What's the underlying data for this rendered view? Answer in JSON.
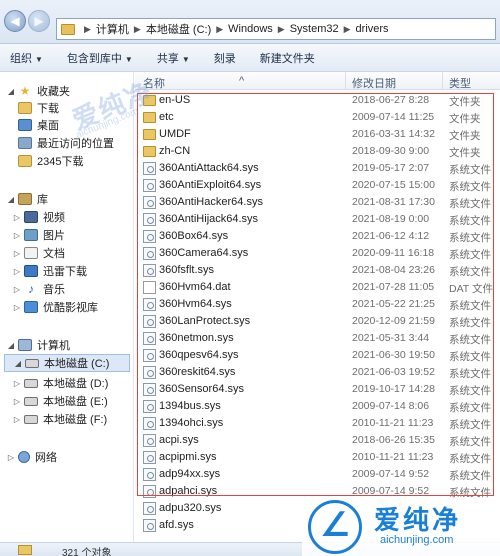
{
  "address": {
    "crumbs": [
      "计算机",
      "本地磁盘 (C:)",
      "Windows",
      "System32",
      "drivers"
    ]
  },
  "toolbar": {
    "organize": "组织",
    "include_library": "包含到库中",
    "share": "共享",
    "burn": "刻录",
    "new_folder": "新建文件夹"
  },
  "nav": {
    "favorites": "收藏夹",
    "downloads": "下载",
    "desktop": "桌面",
    "recent": "最近访问的位置",
    "downloads2345": "2345下载",
    "library": "库",
    "video": "视频",
    "pictures": "图片",
    "documents": "文档",
    "xunlei": "迅雷下载",
    "music": "音乐",
    "youku": "优酷影视库",
    "computer": "计算机",
    "disk_c": "本地磁盘 (C:)",
    "disk_d": "本地磁盘 (D:)",
    "disk_e": "本地磁盘 (E:)",
    "disk_f": "本地磁盘 (F:)",
    "network": "网络"
  },
  "columns": {
    "name": "名称",
    "date": "修改日期",
    "type": "类型"
  },
  "files": [
    {
      "name": "en-US",
      "date": "2018-06-27 8:28",
      "type": "文件夹",
      "icon": "folder"
    },
    {
      "name": "etc",
      "date": "2009-07-14 11:25",
      "type": "文件夹",
      "icon": "folder"
    },
    {
      "name": "UMDF",
      "date": "2016-03-31 14:32",
      "type": "文件夹",
      "icon": "folder"
    },
    {
      "name": "zh-CN",
      "date": "2018-09-30 9:00",
      "type": "文件夹",
      "icon": "folder"
    },
    {
      "name": "360AntiAttack64.sys",
      "date": "2019-05-17 2:07",
      "type": "系统文件",
      "icon": "sys"
    },
    {
      "name": "360AntiExploit64.sys",
      "date": "2020-07-15 15:00",
      "type": "系统文件",
      "icon": "sys"
    },
    {
      "name": "360AntiHacker64.sys",
      "date": "2021-08-31 17:30",
      "type": "系统文件",
      "icon": "sys"
    },
    {
      "name": "360AntiHijack64.sys",
      "date": "2021-08-19 0:00",
      "type": "系统文件",
      "icon": "sys"
    },
    {
      "name": "360Box64.sys",
      "date": "2021-06-12 4:12",
      "type": "系统文件",
      "icon": "sys"
    },
    {
      "name": "360Camera64.sys",
      "date": "2020-09-11 16:18",
      "type": "系统文件",
      "icon": "sys"
    },
    {
      "name": "360fsflt.sys",
      "date": "2021-08-04 23:26",
      "type": "系统文件",
      "icon": "sys"
    },
    {
      "name": "360Hvm64.dat",
      "date": "2021-07-28 11:05",
      "type": "DAT 文件",
      "icon": "dat"
    },
    {
      "name": "360Hvm64.sys",
      "date": "2021-05-22 21:25",
      "type": "系统文件",
      "icon": "sys"
    },
    {
      "name": "360LanProtect.sys",
      "date": "2020-12-09 21:59",
      "type": "系统文件",
      "icon": "sys"
    },
    {
      "name": "360netmon.sys",
      "date": "2021-05-31 3:44",
      "type": "系统文件",
      "icon": "sys"
    },
    {
      "name": "360qpesv64.sys",
      "date": "2021-06-30 19:50",
      "type": "系统文件",
      "icon": "sys"
    },
    {
      "name": "360reskit64.sys",
      "date": "2021-06-03 19:52",
      "type": "系统文件",
      "icon": "sys"
    },
    {
      "name": "360Sensor64.sys",
      "date": "2019-10-17 14:28",
      "type": "系统文件",
      "icon": "sys"
    },
    {
      "name": "1394bus.sys",
      "date": "2009-07-14 8:06",
      "type": "系统文件",
      "icon": "sys"
    },
    {
      "name": "1394ohci.sys",
      "date": "2010-11-21 11:23",
      "type": "系统文件",
      "icon": "sys"
    },
    {
      "name": "acpi.sys",
      "date": "2018-06-26 15:35",
      "type": "系统文件",
      "icon": "sys"
    },
    {
      "name": "acpipmi.sys",
      "date": "2010-11-21 11:23",
      "type": "系统文件",
      "icon": "sys"
    },
    {
      "name": "adp94xx.sys",
      "date": "2009-07-14 9:52",
      "type": "系统文件",
      "icon": "sys"
    },
    {
      "name": "adpahci.sys",
      "date": "2009-07-14 9:52",
      "type": "系统文件",
      "icon": "sys"
    },
    {
      "name": "adpu320.sys",
      "date": "",
      "type": "",
      "icon": "sys"
    },
    {
      "name": "afd.sys",
      "date": "",
      "type": "",
      "icon": "sys"
    }
  ],
  "status": {
    "count": "321 个对象"
  },
  "watermark": {
    "logo_text": "爱纯净",
    "logo_url_text": "aichunjing.com",
    "faint_text": "爱纯净",
    "faint_url_text": "aichunjing.com"
  }
}
